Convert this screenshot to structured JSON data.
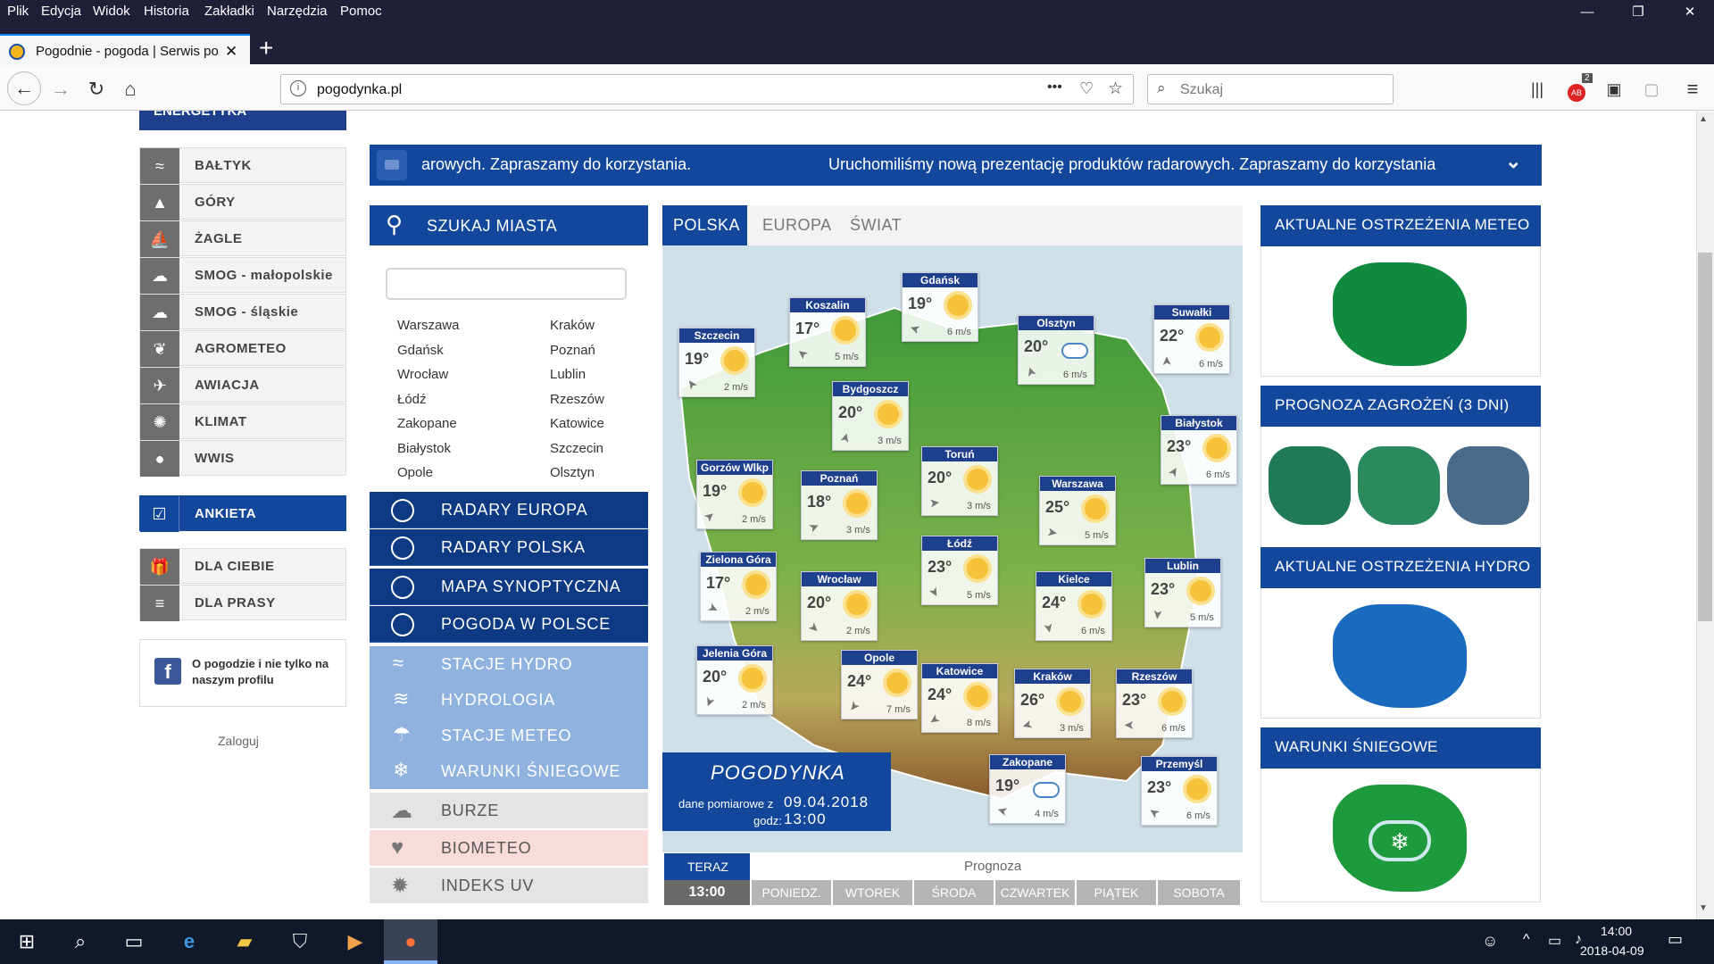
{
  "menu": [
    "Plik",
    "Edycja",
    "Widok",
    "Historia",
    "Zakładki",
    "Narzędzia",
    "Pomoc"
  ],
  "tab": {
    "title": "Pogodnie - pogoda | Serwis po",
    "close": "✕",
    "new": "+"
  },
  "window_controls": {
    "minimize": "—",
    "restore": "❐",
    "close": "✕"
  },
  "url": "pogodynka.pl",
  "url_actions": "•••",
  "search_placeholder": "Szukaj",
  "toolbar_badge": "2",
  "sidebar": {
    "top_item": "ENERGETYKA",
    "items": [
      "BAŁTYK",
      "GÓRY",
      "ŻAGLE",
      "SMOG - małopolskie",
      "SMOG - śląskie",
      "AGROMETEO",
      "AWIACJA",
      "KLIMAT",
      "WWIS"
    ],
    "ankieta": "ANKIETA",
    "extra": [
      "DLA CIEBIE",
      "DLA PRASY"
    ],
    "facebook": "O pogodzie i nie tylko na naszym profilu",
    "login": "Zaloguj"
  },
  "banner": {
    "left": "arowych. Zapraszamy do korzystania.",
    "right": "Uruchomiliśmy nową prezentację produktów radarowych. Zapraszamy do korzystania"
  },
  "search": {
    "title": "SZUKAJ MIASTA",
    "cities_left": [
      "Warszawa",
      "Gdańsk",
      "Wrocław",
      "Łódź",
      "Zakopane",
      "Białystok",
      "Opole"
    ],
    "cities_right": [
      "Kraków",
      "Poznań",
      "Lublin",
      "Rzeszów",
      "Katowice",
      "Szczecin",
      "Olsztyn"
    ]
  },
  "nav_dark": [
    "RADARY EUROPA",
    "RADARY POLSKA",
    "MAPA SYNOPTYCZNA",
    "POGODA W POLSCE"
  ],
  "nav_light": [
    "STACJE HYDRO",
    "HYDROLOGIA",
    "STACJE METEO",
    "WARUNKI ŚNIEGOWE"
  ],
  "nav_other": [
    {
      "label": "BURZE",
      "color": "#e4e4e4"
    },
    {
      "label": "BIOMETEO",
      "color": "#fadbdb"
    },
    {
      "label": "INDEKS UV",
      "color": "#e4e4e4"
    }
  ],
  "map": {
    "tabs": [
      "POLSKA",
      "EUROPA",
      "ŚWIAT"
    ],
    "logo": "POGODYNKA",
    "date_label": "dane pomiarowe z",
    "date_value": "09.04.2018",
    "time_label": "godz:",
    "time_value": "13:00",
    "cities": [
      {
        "name": "Gdańsk",
        "temp": "19°",
        "wind": "6 m/s",
        "icon": "sun-cloud-icon"
      },
      {
        "name": "Koszalin",
        "temp": "17°",
        "wind": "5 m/s",
        "icon": "sun-icon"
      },
      {
        "name": "Szczecin",
        "temp": "19°",
        "wind": "2 m/s",
        "icon": "sun-icon"
      },
      {
        "name": "Olsztyn",
        "temp": "20°",
        "wind": "6 m/s",
        "icon": "cloud-icon"
      },
      {
        "name": "Suwałki",
        "temp": "22°",
        "wind": "6 m/s",
        "icon": "sun-cloud-icon"
      },
      {
        "name": "Bydgoszcz",
        "temp": "20°",
        "wind": "3 m/s",
        "icon": "sun-icon"
      },
      {
        "name": "Białystok",
        "temp": "23°",
        "wind": "6 m/s",
        "icon": "sun-icon"
      },
      {
        "name": "Gorzów Wlkp",
        "temp": "19°",
        "wind": "2 m/s",
        "icon": "sun-icon"
      },
      {
        "name": "Poznań",
        "temp": "18°",
        "wind": "3 m/s",
        "icon": "sun-icon"
      },
      {
        "name": "Toruń",
        "temp": "20°",
        "wind": "3 m/s",
        "icon": "sun-icon"
      },
      {
        "name": "Warszawa",
        "temp": "25°",
        "wind": "5 m/s",
        "icon": "sun-icon"
      },
      {
        "name": "Zielona Góra",
        "temp": "17°",
        "wind": "2 m/s",
        "icon": "sun-icon"
      },
      {
        "name": "Wrocław",
        "temp": "20°",
        "wind": "2 m/s",
        "icon": "sun-icon"
      },
      {
        "name": "Łódź",
        "temp": "23°",
        "wind": "5 m/s",
        "icon": "sun-icon"
      },
      {
        "name": "Kielce",
        "temp": "24°",
        "wind": "6 m/s",
        "icon": "sun-icon"
      },
      {
        "name": "Lublin",
        "temp": "23°",
        "wind": "5 m/s",
        "icon": "sun-icon"
      },
      {
        "name": "Jelenia Góra",
        "temp": "20°",
        "wind": "2 m/s",
        "icon": "sun-icon"
      },
      {
        "name": "Opole",
        "temp": "24°",
        "wind": "7 m/s",
        "icon": "sun-icon"
      },
      {
        "name": "Katowice",
        "temp": "24°",
        "wind": "8 m/s",
        "icon": "sun-cloud-icon"
      },
      {
        "name": "Kraków",
        "temp": "26°",
        "wind": "3 m/s",
        "icon": "sun-icon"
      },
      {
        "name": "Rzeszów",
        "temp": "23°",
        "wind": "6 m/s",
        "icon": "sun-icon"
      },
      {
        "name": "Zakopane",
        "temp": "19°",
        "wind": "4 m/s",
        "icon": "cloud-icon"
      },
      {
        "name": "Przemyśl",
        "temp": "23°",
        "wind": "6 m/s",
        "icon": "sun-icon"
      }
    ]
  },
  "timeline": {
    "now_label": "TERAZ",
    "now_time": "13:00",
    "forecast_label": "Prognoza",
    "days": [
      "PONIEDZ.",
      "WTOREK",
      "ŚRODA",
      "CZWARTEK",
      "PIĄTEK",
      "SOBOTA"
    ]
  },
  "right_cards": [
    {
      "title": "AKTUALNE OSTRZEŻENIA METEO",
      "color": "#0f8a3e"
    },
    {
      "title": "PROGNOZA ZAGROŻEŃ (3 DNI)",
      "color": "#1d8a5a"
    },
    {
      "title": "AKTUALNE OSTRZEŻENIA HYDRO",
      "color": "#1a6ac0"
    },
    {
      "title": "WARUNKI ŚNIEGOWE",
      "color": "#1c9a3c"
    }
  ],
  "card_logo": "POGODYNKA",
  "taskbar": {
    "time": "14:00",
    "date": "2018-04-09"
  },
  "colors": {
    "accent": "#12479b",
    "dark_nav": "#0e3a84",
    "light_nav": "#8fb2de",
    "browser_bg": "#1f1f3a"
  }
}
